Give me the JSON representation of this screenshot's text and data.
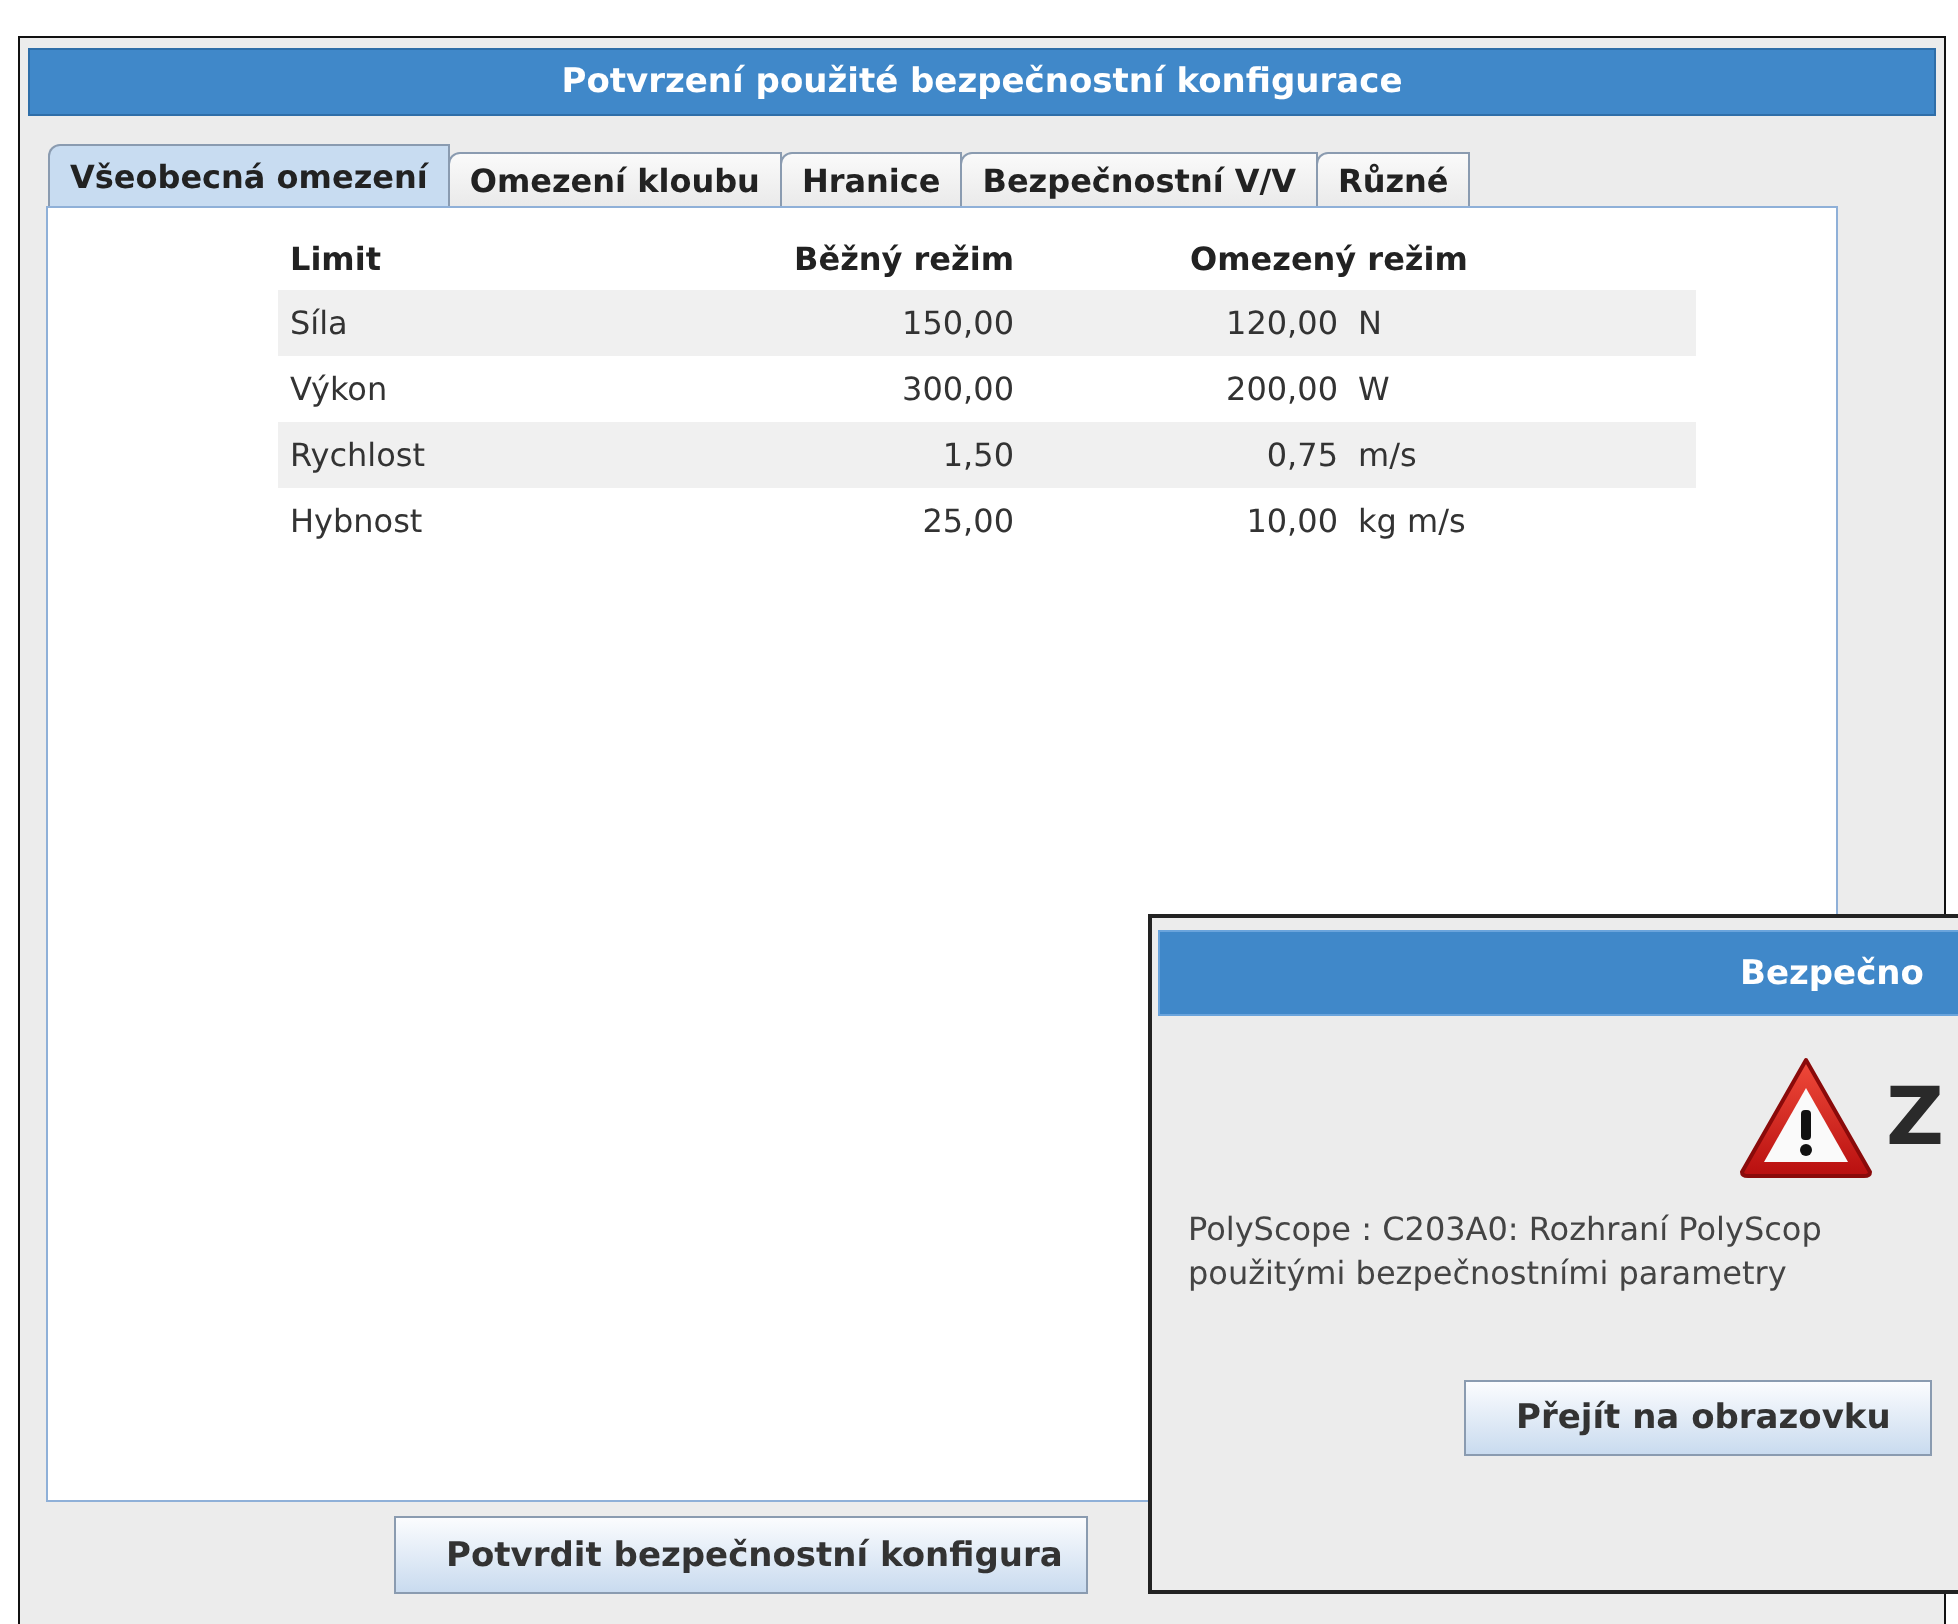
{
  "main_window": {
    "title": "Potvrzení použité bezpečnostní konfigurace",
    "tabs": [
      {
        "label": "Všeobecná omezení",
        "selected": true
      },
      {
        "label": "Omezení kloubu",
        "selected": false
      },
      {
        "label": "Hranice",
        "selected": false
      },
      {
        "label": "Bezpečnostní V/V",
        "selected": false
      },
      {
        "label": "Různé",
        "selected": false
      }
    ],
    "table": {
      "columns": [
        "Limit",
        "Běžný režim",
        "Omezený režim"
      ],
      "rows": [
        {
          "limit": "Síla",
          "normal": "150,00",
          "reduced": "120,00",
          "unit": "N"
        },
        {
          "limit": "Výkon",
          "normal": "300,00",
          "reduced": "200,00",
          "unit": "W"
        },
        {
          "limit": "Rychlost",
          "normal": "1,50",
          "reduced": "0,75",
          "unit": "m/s"
        },
        {
          "limit": "Hybnost",
          "normal": "25,00",
          "reduced": "10,00",
          "unit": "kg m/s"
        }
      ]
    },
    "confirm_button": "Potvrdit bezpečnostní konfigura"
  },
  "dialog": {
    "title": "Bezpečno",
    "heading": "Z",
    "message": "PolyScope : C203A0: Rozhraní PolyScop\npoužitými bezpečnostními parametry",
    "button": "Přejít na obrazovku"
  }
}
